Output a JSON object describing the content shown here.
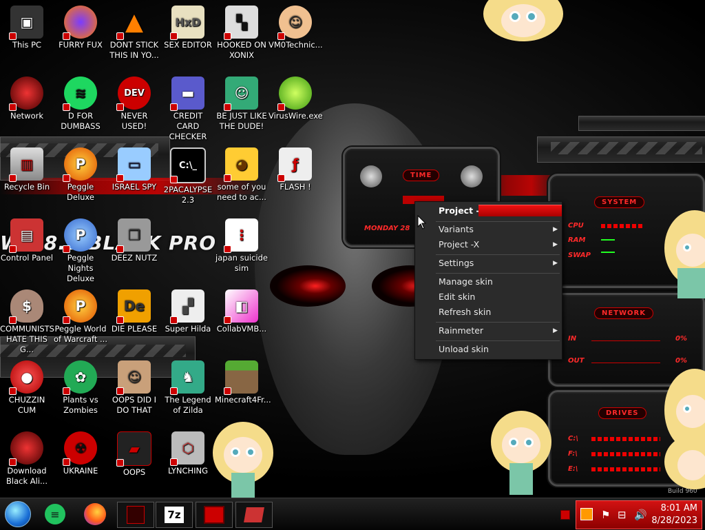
{
  "desktop": {
    "brand_text": "WS 8.1 BLACK PRO",
    "icons": [
      {
        "label": "This PC"
      },
      {
        "label": "FURRY FUX"
      },
      {
        "label": "DONT STICK THIS IN YO..."
      },
      {
        "label": "SEX EDITOR"
      },
      {
        "label": "HOOKED ON XONIX"
      },
      {
        "label": "VM0Technic..."
      },
      {
        "label": "Network"
      },
      {
        "label": "D FOR DUMBASS"
      },
      {
        "label": "NEVER USED!"
      },
      {
        "label": "CREDIT CARD CHECKER"
      },
      {
        "label": "BE JUST LIKE THE DUDE!"
      },
      {
        "label": "VirusWire.exe"
      },
      {
        "label": "Recycle Bin"
      },
      {
        "label": "Peggle Deluxe"
      },
      {
        "label": "ISRAEL SPY"
      },
      {
        "label": "2PACALYPSE 2.3"
      },
      {
        "label": "some of you need to ac..."
      },
      {
        "label": "FLASH !"
      },
      {
        "label": "Control Panel"
      },
      {
        "label": "Peggle Nights Deluxe"
      },
      {
        "label": "DEEZ NUTZ"
      },
      {
        "label": "japan suicide sim"
      },
      {
        "label": "COMMUNISTS HATE THIS G..."
      },
      {
        "label": "Peggle World of Warcraft ..."
      },
      {
        "label": "DIE PLEASE"
      },
      {
        "label": "Super Hilda"
      },
      {
        "label": "CollabVMB..."
      },
      {
        "label": "CHUZZIN CUM"
      },
      {
        "label": "Plants vs Zombies"
      },
      {
        "label": "OOPS DID I DO THAT"
      },
      {
        "label": "The Legend of Zilda"
      },
      {
        "label": "Minecraft4Fr..."
      },
      {
        "label": "Download Black Ali..."
      },
      {
        "label": "UKRAINE"
      },
      {
        "label": "OOPS"
      },
      {
        "label": "LYNCHING"
      }
    ]
  },
  "skins": {
    "time": {
      "title": "TIME",
      "date": "MONDAY 28"
    },
    "system": {
      "title": "SYSTEM",
      "rows": [
        "CPU",
        "RAM",
        "SWAP"
      ]
    },
    "network": {
      "title": "NETWORK",
      "rows": [
        {
          "label": "IN",
          "value": "0%"
        },
        {
          "label": "OUT",
          "value": "0%"
        }
      ]
    },
    "drives": {
      "title": "DRIVES",
      "rows": [
        "C:\\",
        "F:\\",
        "E:\\"
      ]
    }
  },
  "context_menu": {
    "header": "Project -X",
    "items": [
      {
        "label": "Variants",
        "submenu": true
      },
      {
        "label": "Project -X",
        "submenu": true
      },
      {
        "label": "Settings",
        "submenu": true
      },
      {
        "label": "Manage skin",
        "submenu": false
      },
      {
        "label": "Edit skin",
        "submenu": false
      },
      {
        "label": "Refresh skin",
        "submenu": false
      },
      {
        "label": "Rainmeter",
        "submenu": true
      },
      {
        "label": "Unload skin",
        "submenu": false
      }
    ]
  },
  "taskbar": {
    "pinned": [
      "start-orb",
      "green-chat-app",
      "firefox",
      "alienware-app",
      "7zip",
      "red-app",
      "control-panel-app"
    ],
    "label_7z": "7z",
    "clock": {
      "time": "8:01 AM",
      "date": "8/28/2023"
    },
    "build_text": "Build 960"
  },
  "colors": {
    "accent": "#e01010",
    "tray": "#c21010",
    "menu_bg": "#2b2b2b"
  }
}
